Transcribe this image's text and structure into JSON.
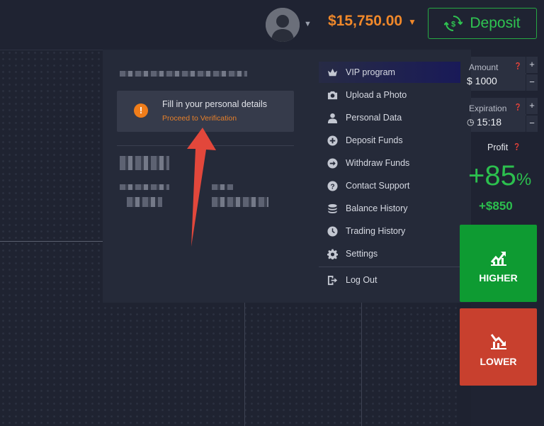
{
  "header": {
    "balance": "$15,750.00",
    "deposit_label": "Deposit"
  },
  "profile": {
    "verify_title": "Fill in your personal details",
    "verify_link": "Proceed to Verification"
  },
  "menu": {
    "items": [
      {
        "label": "VIP program",
        "icon": "crown-icon"
      },
      {
        "label": "Upload a Photo",
        "icon": "camera-icon"
      },
      {
        "label": "Personal Data",
        "icon": "user-icon"
      },
      {
        "label": "Deposit Funds",
        "icon": "plus-circle-icon"
      },
      {
        "label": "Withdraw Funds",
        "icon": "arrow-right-circle-icon"
      },
      {
        "label": "Contact Support",
        "icon": "question-circle-icon"
      },
      {
        "label": "Balance History",
        "icon": "coins-stack-icon"
      },
      {
        "label": "Trading History",
        "icon": "clock-icon"
      },
      {
        "label": "Settings",
        "icon": "gear-icon"
      }
    ],
    "logout_label": "Log Out"
  },
  "trade": {
    "amount_label": "Amount",
    "amount_value": "$ 1000",
    "expiration_label": "Expiration",
    "expiration_value": "15:18",
    "profit_label": "Profit",
    "profit_pct": "+85",
    "profit_pct_unit": "%",
    "profit_amount": "+$850",
    "higher_label": "HIGHER",
    "lower_label": "LOWER",
    "plus": "+",
    "minus": "−"
  },
  "colors": {
    "accent_orange": "#f0882a",
    "accent_green": "#2cbf4e",
    "higher_bg": "#0e9b32",
    "lower_bg": "#c8402e",
    "annotation_arrow": "#e2473b"
  }
}
